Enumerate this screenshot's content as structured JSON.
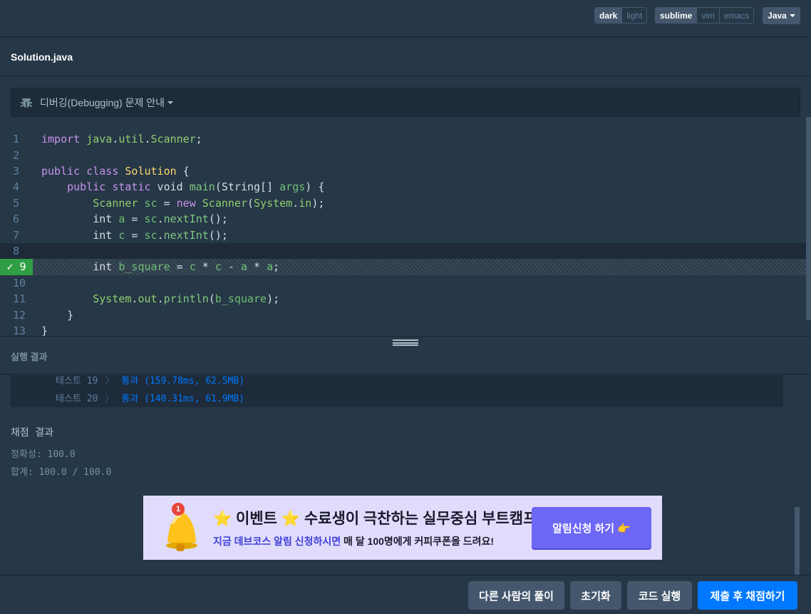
{
  "toolbar": {
    "theme_options": [
      "dark",
      "light"
    ],
    "theme_selected": "dark",
    "keymap_options": [
      "sublime",
      "vim",
      "emacs"
    ],
    "keymap_selected": "sublime",
    "language": "Java"
  },
  "file": {
    "name": "Solution.java"
  },
  "guide": {
    "label": "디버깅(Debugging) 문제 안내"
  },
  "editor": {
    "lines": [
      {
        "n": "1",
        "text": "import java.util.Scanner;"
      },
      {
        "n": "2",
        "text": ""
      },
      {
        "n": "3",
        "text": "public class Solution {"
      },
      {
        "n": "4",
        "text": "    public static void main(String[] args) {"
      },
      {
        "n": "5",
        "text": "        Scanner sc = new Scanner(System.in);"
      },
      {
        "n": "6",
        "text": "        int a = sc.nextInt();"
      },
      {
        "n": "7",
        "text": "        int c = sc.nextInt();"
      },
      {
        "n": "8",
        "text": ""
      },
      {
        "n": "9",
        "text": "        int b_square = c * c - a * a;"
      },
      {
        "n": "10",
        "text": ""
      },
      {
        "n": "11",
        "text": "        System.out.println(b_square);"
      },
      {
        "n": "12",
        "text": "    }"
      },
      {
        "n": "13",
        "text": "}"
      }
    ],
    "checked_line_label": "✓ 9"
  },
  "results": {
    "title": "실행 결과",
    "tests": [
      {
        "name": "테스트 19",
        "sep": "〉",
        "value": "통과 (159.78ms, 62.5MB)"
      },
      {
        "name": "테스트 20",
        "sep": "〉",
        "value": "통과 (140.31ms, 61.9MB)"
      }
    ],
    "score_title": "채점 결과",
    "accuracy": "정확성: 100.0",
    "total": "합계: 100.0 / 100.0"
  },
  "banner": {
    "badge": "1",
    "title_prefix": "이벤트",
    "title_suffix": "수료생이 극찬하는 실무중심 부트캠프",
    "subtitle_a": "지금 데브코스 알림 신청하시면",
    "subtitle_b": "매 달 100명에게 커피쿠폰을 드려요!",
    "button": "알림신청 하기 👉"
  },
  "footer": {
    "others": "다른 사람의 풀이",
    "reset": "초기화",
    "run": "코드 실행",
    "submit": "제출 후 채점하기"
  },
  "colors": {
    "background": "#263747",
    "primary": "#0078ff",
    "success": "#2f9e44",
    "banner_bg": "#e1dcfb",
    "banner_button": "#6c67f5"
  }
}
